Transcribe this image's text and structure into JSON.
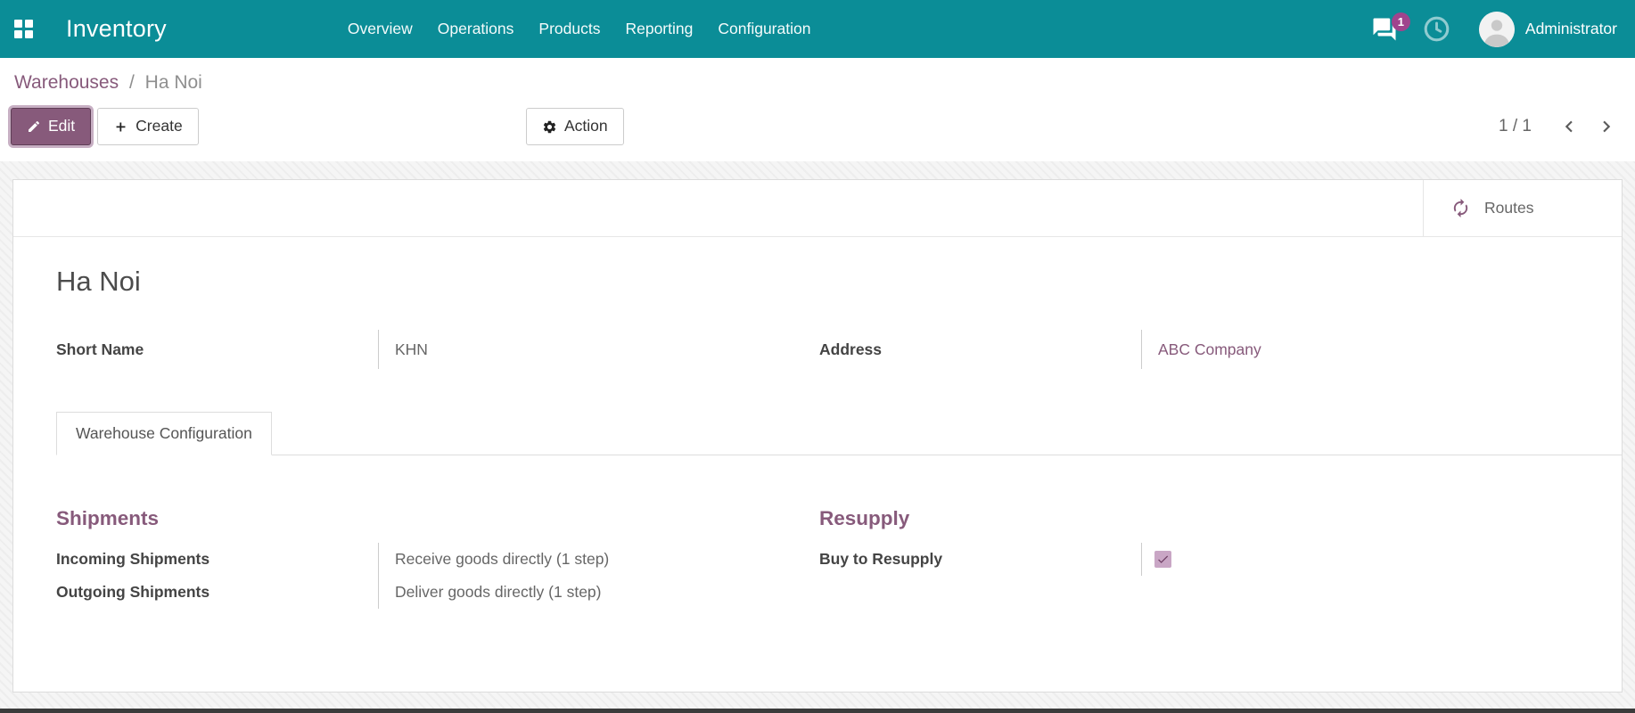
{
  "navbar": {
    "brand": "Inventory",
    "menus": [
      "Overview",
      "Operations",
      "Products",
      "Reporting",
      "Configuration"
    ],
    "messages_count": "1",
    "user_name": "Administrator"
  },
  "breadcrumb": {
    "parent": "Warehouses",
    "separator": "/",
    "current": "Ha Noi"
  },
  "control_panel": {
    "edit_label": "Edit",
    "create_label": "Create",
    "action_label": "Action",
    "pager_value": "1 / 1"
  },
  "sheet": {
    "routes_button": "Routes",
    "title": "Ha Noi",
    "fields": {
      "short_name": {
        "label": "Short Name",
        "value": "KHN"
      },
      "address": {
        "label": "Address",
        "value": "ABC Company"
      }
    },
    "tab": "Warehouse Configuration",
    "shipments": {
      "heading": "Shipments",
      "rows": [
        {
          "label": "Incoming Shipments",
          "value": "Receive goods directly (1 step)"
        },
        {
          "label": "Outgoing Shipments",
          "value": "Deliver goods directly (1 step)"
        }
      ]
    },
    "resupply": {
      "heading": "Resupply",
      "rows": [
        {
          "label": "Buy to Resupply",
          "checked": true
        }
      ]
    }
  },
  "colors": {
    "header": "#0b8d97",
    "accent": "#875A7B",
    "badge": "#a0448d",
    "checkbox_bg": "#c9a6c5",
    "checkbox_check": "#6e3f64"
  }
}
